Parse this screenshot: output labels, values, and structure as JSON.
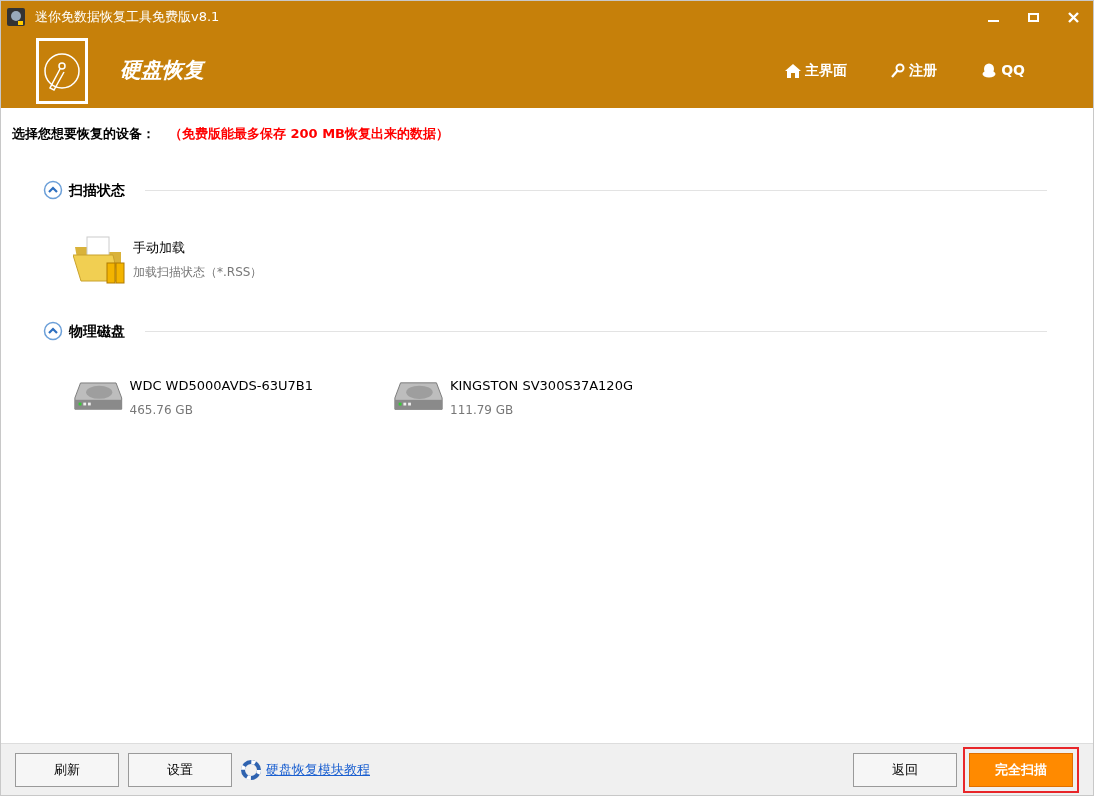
{
  "window": {
    "title": "迷你免数据恢复工具免费版v8.1"
  },
  "header": {
    "module_title": "硬盘恢复",
    "nav": [
      {
        "label": "主界面",
        "kind": "home"
      },
      {
        "label": "注册",
        "kind": "key"
      },
      {
        "label": "QQ",
        "kind": "qq"
      }
    ]
  },
  "prompt": {
    "label": "选择您想要恢复的设备：",
    "notice": "（免费版能最多保存 200 MB恢复出来的数据）"
  },
  "sections": [
    {
      "title": "扫描状态",
      "expanded": true,
      "items": [
        {
          "kind": "folder",
          "name": "手动加载",
          "detail": "加载扫描状态（*.RSS）"
        }
      ]
    },
    {
      "title": "物理磁盘",
      "expanded": true,
      "items": [
        {
          "kind": "disk",
          "name": "WDC WD5000AVDS-63U7B1",
          "detail": "465.76 GB"
        },
        {
          "kind": "disk",
          "name": "KINGSTON SV300S37A120G",
          "detail": "111.79 GB"
        }
      ]
    }
  ],
  "footer": {
    "left_buttons": [
      "刷新",
      "设置"
    ],
    "tutorial_link": "硬盘恢复模块教程",
    "back_button": "返回",
    "scan_button": {
      "label": "完全扫描",
      "highlighted": true
    }
  }
}
